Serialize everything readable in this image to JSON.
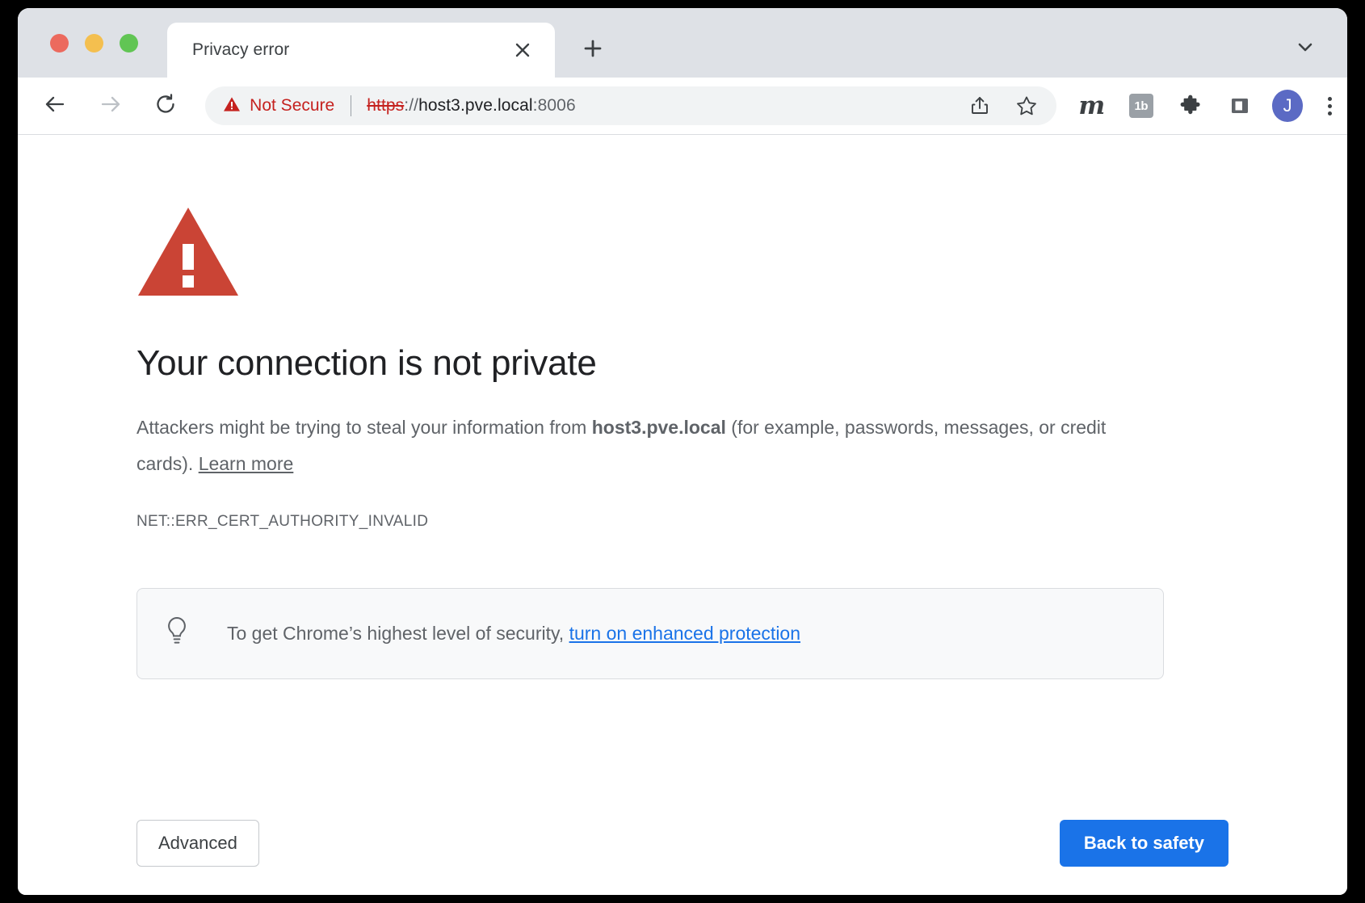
{
  "window": {
    "traffic_lights": [
      "close",
      "minimize",
      "zoom"
    ]
  },
  "tabstrip": {
    "tab_title": "Privacy error",
    "close_tab_icon": "close-icon",
    "new_tab_icon": "plus-icon",
    "tab_search_icon": "chevron-down-icon"
  },
  "toolbar": {
    "back_icon": "arrow-left-icon",
    "forward_icon": "arrow-right-icon",
    "reload_icon": "reload-icon",
    "security_icon": "warning-triangle-icon",
    "security_label": "Not Secure",
    "url": {
      "scheme": "https",
      "separator": "://",
      "host": "host3.pve.local",
      "port": ":8006"
    },
    "share_icon": "share-icon",
    "bookmark_icon": "star-icon",
    "extensions": [
      {
        "name": "m-extension-icon",
        "label": "m"
      },
      {
        "name": "1b-extension-icon",
        "label": "1b"
      },
      {
        "name": "puzzle-icon",
        "label": ""
      },
      {
        "name": "side-panel-icon",
        "label": ""
      }
    ],
    "avatar_initial": "J",
    "menu_icon": "kebab-menu-icon"
  },
  "interstitial": {
    "icon": "warning-triangle-icon",
    "heading": "Your connection is not private",
    "body_prefix": "Attackers might be trying to steal your information from ",
    "body_host": "host3.pve.local",
    "body_suffix": " (for example, passwords, messages, or credit cards). ",
    "learn_more": "Learn more",
    "error_code": "NET::ERR_CERT_AUTHORITY_INVALID",
    "callout": {
      "icon": "lightbulb-icon",
      "text": "To get Chrome’s highest level of security, ",
      "link": "turn on enhanced protection"
    },
    "advanced_button": "Advanced",
    "primary_button": "Back to safety"
  },
  "colors": {
    "danger": "#c5221f",
    "warning_triangle": "#ca4435",
    "link": "#1a73e8",
    "primary_button": "#1a73e8",
    "avatar": "#5b6ac4",
    "tabstrip": "#dee1e6"
  }
}
